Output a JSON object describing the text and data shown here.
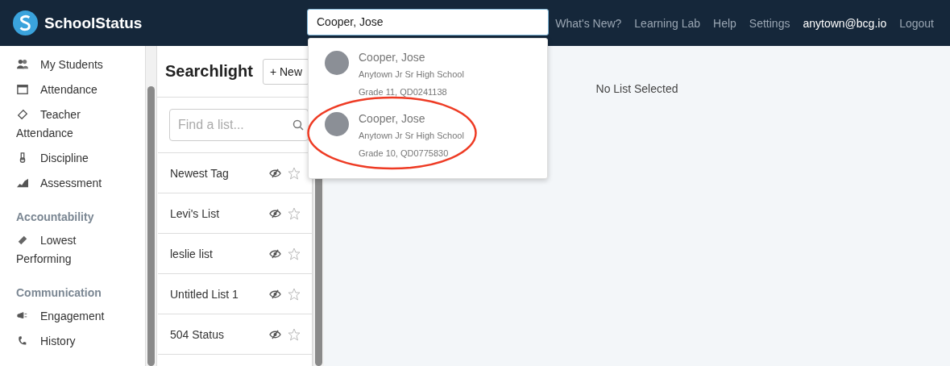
{
  "header": {
    "brand": "SchoolStatus",
    "search": {
      "value": "Cooper, Jose"
    },
    "nav": [
      {
        "label": "What's New?",
        "kind": "link"
      },
      {
        "label": "Learning Lab",
        "kind": "link"
      },
      {
        "label": "Help",
        "kind": "link"
      },
      {
        "label": "Settings",
        "kind": "link"
      },
      {
        "label": "anytown@bcg.io",
        "kind": "account"
      },
      {
        "label": "Logout",
        "kind": "link"
      }
    ]
  },
  "search_results": [
    {
      "name": "Cooper, Jose",
      "school": "Anytown Jr Sr High School",
      "detail": "Grade 11, QD0241138",
      "circled": false
    },
    {
      "name": "Cooper, Jose",
      "school": "Anytown Jr Sr High School",
      "detail": "Grade 10, QD0775830",
      "circled": true
    }
  ],
  "sidebar": {
    "items": [
      {
        "kind": "item",
        "label": "My Students"
      },
      {
        "kind": "item",
        "label": "Attendance"
      },
      {
        "kind": "item",
        "label": "Teacher Attendance"
      },
      {
        "kind": "item",
        "label": "Discipline"
      },
      {
        "kind": "item",
        "label": "Assessment"
      },
      {
        "kind": "heading",
        "label": "Accountability"
      },
      {
        "kind": "item",
        "label": "Lowest Performing"
      },
      {
        "kind": "heading",
        "label": "Communication"
      },
      {
        "kind": "item",
        "label": "Engagement"
      },
      {
        "kind": "item",
        "label": "History"
      }
    ]
  },
  "searchlight": {
    "title": "Searchlight",
    "new_button": "+ New",
    "find": {
      "placeholder": "Find a list..."
    },
    "lists": [
      {
        "name": "Newest Tag",
        "starred": false
      },
      {
        "name": "Levi's List",
        "starred": false
      },
      {
        "name": "leslie list",
        "starred": false
      },
      {
        "name": "Untitled List 1",
        "starred": false
      },
      {
        "name": "504 Status",
        "starred": false
      }
    ]
  },
  "main": {
    "message": "No List Selected"
  }
}
